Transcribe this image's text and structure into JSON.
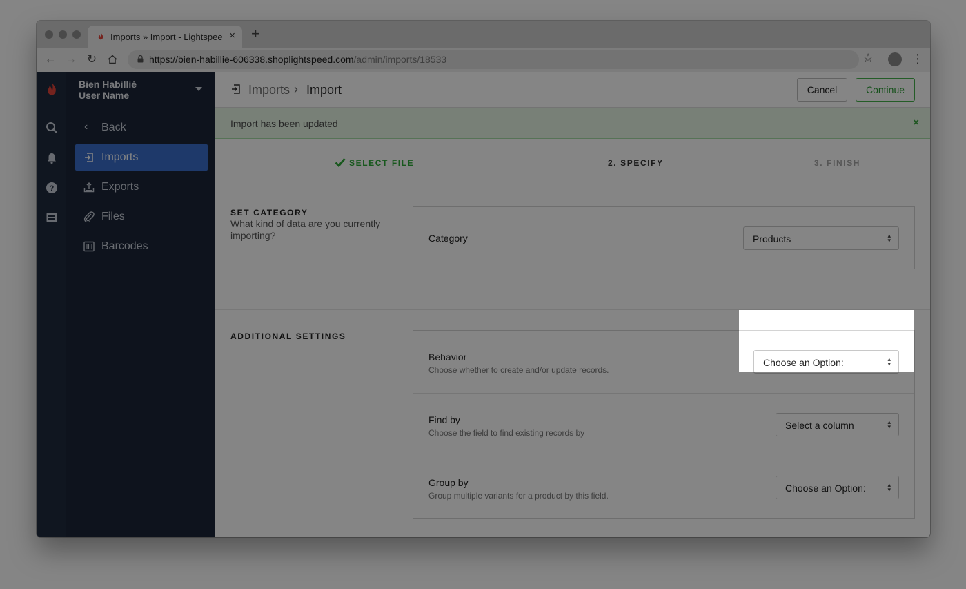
{
  "browser": {
    "tab_title": "Imports » Import - Lightspeed",
    "url_host": "https://bien-habillie-606338.shoplightspeed.com",
    "url_path": "/admin/imports/18533"
  },
  "sidebar": {
    "store_name": "Bien Habillié",
    "user_name": "User Name",
    "back_label": "Back",
    "items": [
      {
        "label": "Imports",
        "active": true,
        "icon": "imports-icon"
      },
      {
        "label": "Exports",
        "active": false,
        "icon": "exports-icon"
      },
      {
        "label": "Files",
        "active": false,
        "icon": "paperclip-icon"
      },
      {
        "label": "Barcodes",
        "active": false,
        "icon": "barcode-icon"
      }
    ]
  },
  "header": {
    "crumb_parent": "Imports",
    "crumb_current": "Import",
    "cancel_label": "Cancel",
    "continue_label": "Continue"
  },
  "alert": {
    "text": "Import has been updated",
    "close": "×",
    "color": "#e6f6e4"
  },
  "steps": [
    {
      "label": "SELECT FILE",
      "state": "done",
      "color": "#2fa939"
    },
    {
      "label": "2. SPECIFY",
      "state": "current",
      "color": "#333333"
    },
    {
      "label": "3. FINISH",
      "state": "upcoming",
      "color": "#a5a5a5"
    }
  ],
  "category_section": {
    "title": "SET CATEGORY",
    "description": "What kind of data are you currently importing?",
    "field_label": "Category",
    "selected": "Products"
  },
  "additional_section": {
    "title": "ADDITIONAL SETTINGS",
    "rows": [
      {
        "title": "Behavior",
        "description": "Choose whether to create and/or update records.",
        "selected": "Choose an Option:"
      },
      {
        "title": "Find by",
        "description": "Choose the field to find existing records by",
        "selected": "Select a column"
      },
      {
        "title": "Group by",
        "description": "Group multiple variants for a product by this field.",
        "selected": "Choose an Option:"
      }
    ]
  },
  "colors": {
    "sidebar_bg": "#1b2638",
    "active_item": "#3a6ecb",
    "primary_green": "#45b04c"
  }
}
